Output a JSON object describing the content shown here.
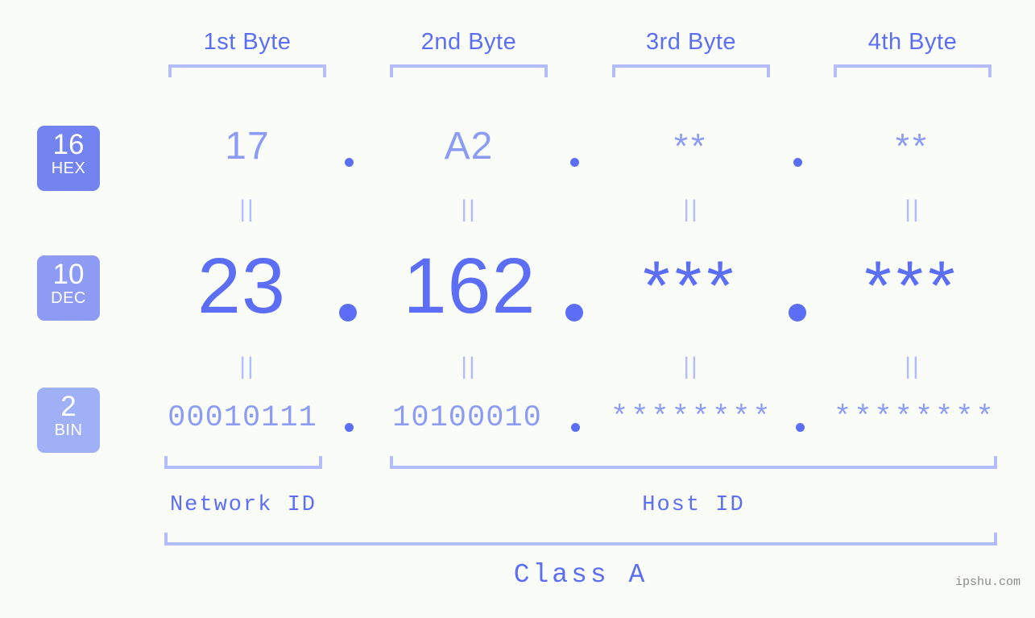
{
  "meta": {
    "background_color": "#fafdf7",
    "accent_strong": "#5b6ef5",
    "accent_mid": "#8c9bf4",
    "accent_light": "#b3bdfb",
    "watermark": "ipshu.com"
  },
  "byte_headers": [
    {
      "label": "1st Byte"
    },
    {
      "label": "2nd Byte"
    },
    {
      "label": "3rd Byte"
    },
    {
      "label": "4th Byte"
    }
  ],
  "bases": [
    {
      "number": "16",
      "name": "HEX",
      "color": "#7383ef"
    },
    {
      "number": "10",
      "name": "DEC",
      "color": "#8d9bf4"
    },
    {
      "number": "2",
      "name": "BIN",
      "color": "#9fb0f7"
    }
  ],
  "rows": {
    "hex": {
      "base_number": "16",
      "base_name": "HEX",
      "values": [
        "17",
        "A2",
        "**",
        "**"
      ],
      "separators": [
        ".",
        ".",
        "."
      ]
    },
    "dec": {
      "base_number": "10",
      "base_name": "DEC",
      "values": [
        "23",
        "162",
        "***",
        "***"
      ],
      "separators": [
        ".",
        ".",
        "."
      ]
    },
    "bin": {
      "base_number": "2",
      "base_name": "BIN",
      "values": [
        "00010111",
        "10100010",
        "********",
        "********"
      ],
      "separators": [
        ".",
        ".",
        "."
      ]
    }
  },
  "equality_markers": {
    "symbol": "||",
    "count_per_row": 4,
    "rows": 2
  },
  "sections": [
    {
      "label": "Network ID"
    },
    {
      "label": "Host ID"
    }
  ],
  "class": {
    "label": "Class A"
  }
}
